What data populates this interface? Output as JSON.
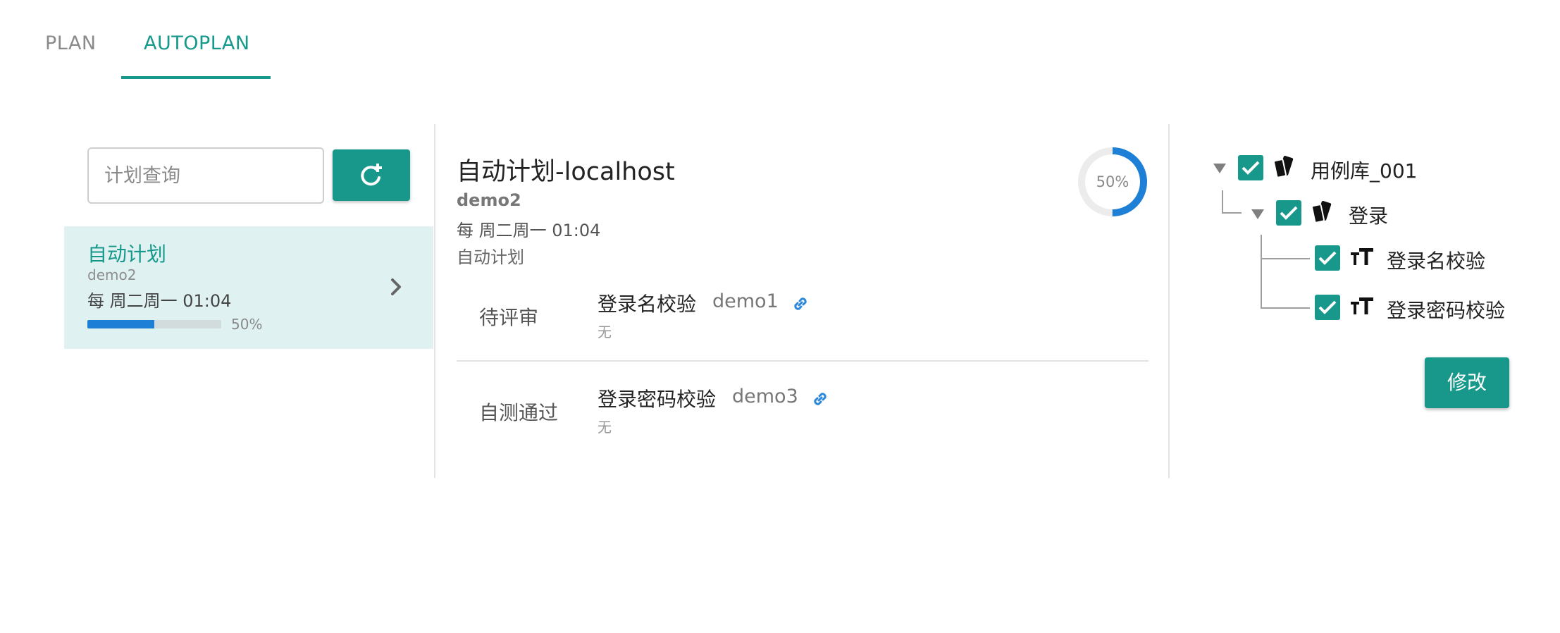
{
  "tabs": [
    {
      "label": "PLAN",
      "active": false
    },
    {
      "label": "AUTOPLAN",
      "active": true
    }
  ],
  "search": {
    "placeholder": "计划查询",
    "value": ""
  },
  "add_button_icon": "refresh-plus-icon",
  "plan_list": [
    {
      "title": "自动计划",
      "project": "demo2",
      "schedule": "每 周二周一 01:04",
      "progress": 0.5,
      "progress_label": "50%"
    }
  ],
  "detail": {
    "title": "自动计划-localhost",
    "project": "demo2",
    "schedule": "每 周二周一 01:04",
    "type": "自动计划",
    "progress": 0.5,
    "progress_label": "50%",
    "cases": [
      {
        "status": "待评审",
        "name": "登录名校验",
        "user": "demo1",
        "note": "无"
      },
      {
        "status": "自测通过",
        "name": "登录密码校验",
        "user": "demo3",
        "note": "无"
      }
    ]
  },
  "tree": {
    "root": {
      "label": "用例库_001",
      "checked": true,
      "icon": "library-icon"
    },
    "module": {
      "label": "登录",
      "checked": true,
      "icon": "library-icon"
    },
    "cases": [
      {
        "label": "登录名校验",
        "checked": true,
        "icon": "text-case-icon"
      },
      {
        "label": "登录密码校验",
        "checked": true,
        "icon": "text-case-icon"
      }
    ]
  },
  "edit_button": "修改",
  "colors": {
    "accent": "#17988b",
    "progress": "#1e7fd6",
    "selected_bg": "#e0f1f1",
    "link": "#2b87d8"
  }
}
